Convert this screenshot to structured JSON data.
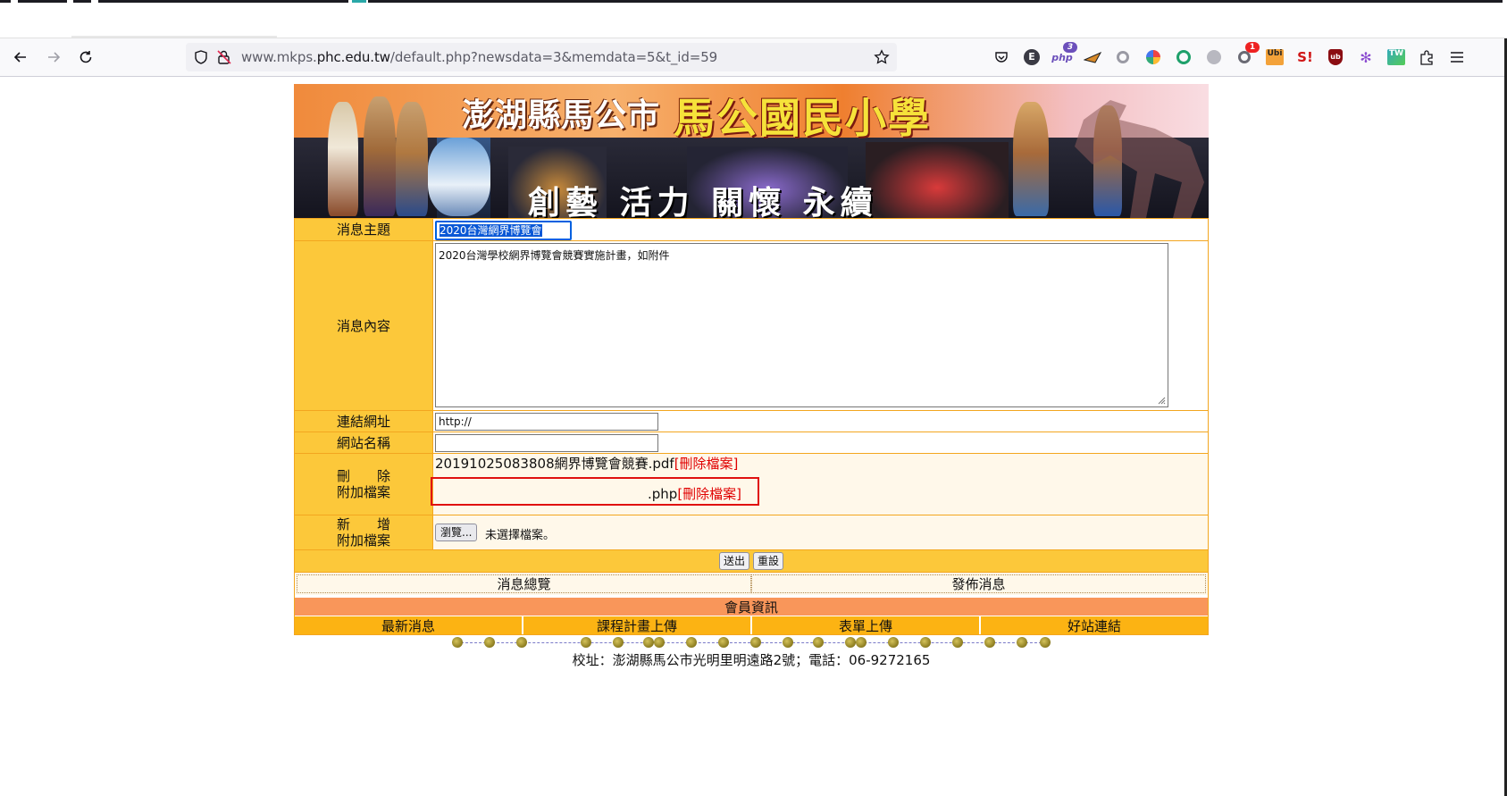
{
  "browser": {
    "url_prefix": "www.mkps.",
    "url_host": "phc.edu.tw",
    "url_path": "/default.php?newsdata=3&memdata=5&t_id=59",
    "ext_badges": {
      "php": "3",
      "gear": "1"
    },
    "ext_labels": {
      "e": "E",
      "php": "php",
      "ubi": "Ubi",
      "s": "S!",
      "ub": "ub",
      "tw": "TW"
    }
  },
  "banner": {
    "title_city": "澎湖縣馬公市",
    "title_school": "馬公國民小學",
    "slogan": "創藝 活力  關懷 永續"
  },
  "form": {
    "subject_label": "消息主題",
    "subject_value": "2020台灣網界博覽會",
    "content_label": "消息內容",
    "content_value": "2020台灣學校網界博覽會競賽實施計畫，如附件",
    "link_label": "連結網址",
    "link_value": "http://",
    "site_label": "網站名稱",
    "site_value": "",
    "delete_label_1": "刪　　除",
    "delete_label_2": "附加檔案",
    "file1_name": "20191025083808網界博覽會競賽.pdf",
    "file1_delete": "[刪除檔案]",
    "file2_name": ".php",
    "file2_delete": "[刪除檔案]",
    "add_label_1": "新　　增",
    "add_label_2": "附加檔案",
    "browse_label": "瀏覽...",
    "no_file": "未選擇檔案。",
    "submit_label": "送出",
    "reset_label": "重設"
  },
  "subnav": {
    "overview": "消息總覽",
    "publish": "發佈消息"
  },
  "member_info": "會員資訊",
  "menu": [
    "最新消息",
    "課程計畫上傳",
    "表單上傳",
    "好站連結"
  ],
  "footer": "校址：澎湖縣馬公市光明里明遠路2號；電話：06-9272165",
  "colors": {
    "label_bg": "#fcc83a",
    "border": "#f3a61f",
    "member_bar": "#f9965a",
    "menu_bar": "#fcb313",
    "delete_link": "#e00000",
    "highlight_box": "#e01010"
  }
}
